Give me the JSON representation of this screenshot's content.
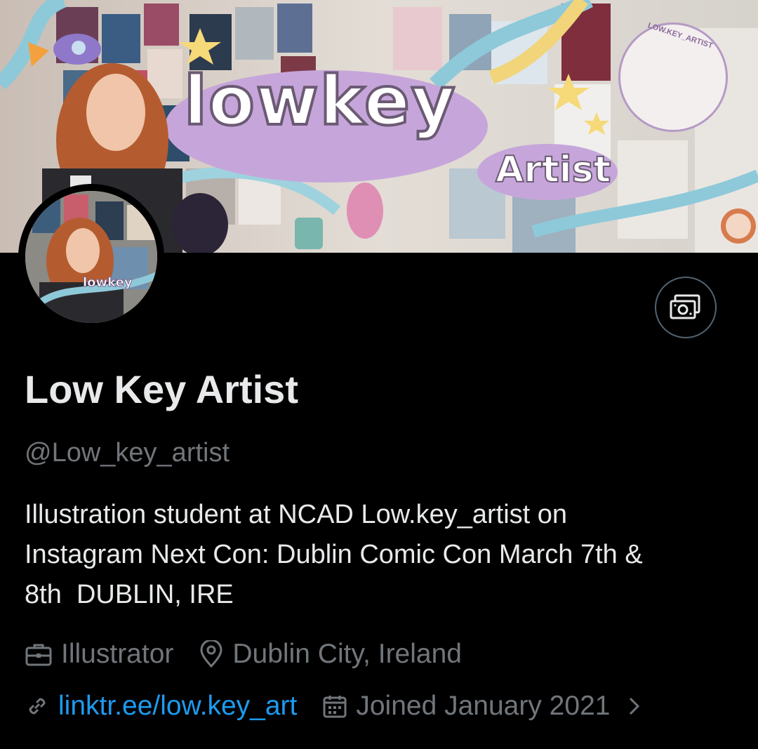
{
  "banner": {
    "title_text": "lowkey",
    "subtitle_text": "Artist",
    "badge_text": "LOW.KEY_ARTIST"
  },
  "avatar": {
    "text": "lowkey"
  },
  "profile": {
    "display_name": "Low Key Artist",
    "handle": "@Low_key_artist",
    "bio": "Illustration student at NCAD Low.key_artist on\nInstagram Next Con: Dublin Comic Con March 7th &\n8th  DUBLIN, IRE",
    "profession": "Illustrator",
    "location": "Dublin City, Ireland",
    "website": "linktr.ee/low.key_art",
    "joined": "Joined January 2021"
  },
  "icons": {
    "tips": "money-icon",
    "profession": "briefcase-icon",
    "location": "location-pin-icon",
    "website": "link-icon",
    "joined": "calendar-icon",
    "more": "chevron-right-icon"
  },
  "colors": {
    "background": "#000000",
    "text": "#e7e9ea",
    "secondary": "#71767b",
    "link": "#1d9bf0",
    "border": "#536471"
  }
}
